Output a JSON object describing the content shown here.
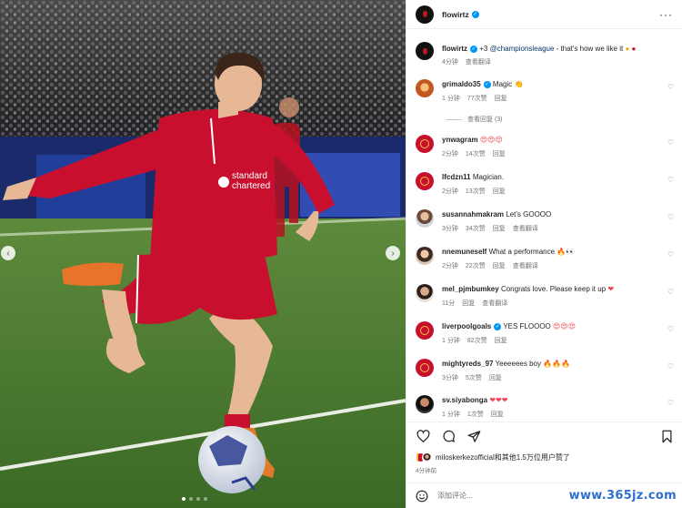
{
  "post": {
    "author": "flowirtz",
    "caption": {
      "user": "flowirtz",
      "plus": "+3",
      "mention": "@championsleague",
      "text": " - that's how we like it ",
      "time": "4分钟",
      "translate": "查看翻译"
    },
    "photo_alt_icons": {
      "prev": "chevron-left-icon",
      "next": "chevron-right-icon"
    },
    "likes": {
      "users_text": "miloskerkezofficial和其他1.5万位用户赞了",
      "time": "4分钟前"
    },
    "add_comment_placeholder": "添加评论..."
  },
  "comments": [
    {
      "user": "grimaldo35",
      "verified": true,
      "text": "Magic ",
      "emoji": "👏",
      "time": "1 分钟",
      "likes": "77次赞",
      "reply": "回复",
      "translate": ""
    },
    {
      "user": "ynwagram",
      "verified": false,
      "text": "",
      "emoji": "😍😍😍",
      "time": "2分钟",
      "likes": "14次赞",
      "reply": "回复",
      "translate": ""
    },
    {
      "user": "lfcdzn11",
      "verified": false,
      "text": "Magician.",
      "emoji": "",
      "time": "2分钟",
      "likes": "13次赞",
      "reply": "回复",
      "translate": ""
    },
    {
      "user": "susannahmakram",
      "verified": false,
      "text": "Let's GOOOO",
      "emoji": "",
      "time": "3分钟",
      "likes": "34次赞",
      "reply": "回复",
      "translate": "查看翻译"
    },
    {
      "user": "nnemuneself",
      "verified": false,
      "text": "What a performance ",
      "emoji": "🔥👀",
      "time": "2分钟",
      "likes": "22次赞",
      "reply": "回复",
      "translate": "查看翻译"
    },
    {
      "user": "mel_pjmbumkey",
      "verified": false,
      "text": "Congrats love. Please keep it up ",
      "emoji": "❤",
      "time": "11分",
      "likes": "",
      "reply": "回复",
      "translate": "查看翻译"
    },
    {
      "user": "liverpoolgoals",
      "verified": true,
      "text": "YES FLOOOO ",
      "emoji": "😍😍😍",
      "time": "1 分钟",
      "likes": "82次赞",
      "reply": "回复",
      "translate": ""
    },
    {
      "user": "mightyreds_97",
      "verified": false,
      "text": "Yeeeeees boy ",
      "emoji": "🔥🔥🔥",
      "time": "3分钟",
      "likes": "5次赞",
      "reply": "回复",
      "translate": ""
    },
    {
      "user": "sv.siyabonga",
      "verified": false,
      "text": "",
      "emoji": "❤❤❤",
      "time": "1 分钟",
      "likes": "1次赞",
      "reply": "回复",
      "translate": ""
    }
  ],
  "view_replies": "查看回复 (3)",
  "watermark": "www.365jz.com",
  "colors": {
    "lfc_red": "#c8102e",
    "link": "#00376b",
    "verified": "#0095f6",
    "heart": "#ed4956"
  }
}
